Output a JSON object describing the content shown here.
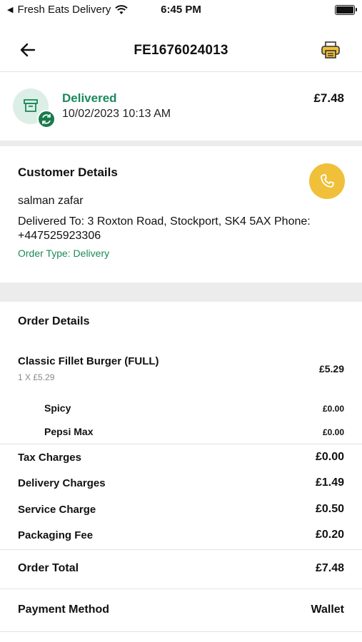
{
  "status_bar": {
    "carrier": "Fresh Eats Delivery",
    "time": "6:45 PM"
  },
  "header": {
    "title": "FE1676024013"
  },
  "summary": {
    "status": "Delivered",
    "datetime": "10/02/2023 10:13 AM",
    "amount": "£7.48"
  },
  "customer": {
    "heading": "Customer Details",
    "name": "salman zafar",
    "address": "Delivered To: 3 Roxton Road, Stockport, SK4 5AX Phone: +447525923306",
    "order_type": "Order Type: Delivery"
  },
  "order": {
    "heading": "Order Details",
    "item": {
      "name": "Classic Fillet Burger (FULL)",
      "qty": "1 X £5.29",
      "price": "£5.29"
    },
    "addons": [
      {
        "name": "Spicy",
        "price": "£0.00"
      },
      {
        "name": "Pepsi Max",
        "price": "£0.00"
      }
    ]
  },
  "charges": [
    {
      "label": "Tax Charges",
      "value": "£0.00"
    },
    {
      "label": "Delivery Charges",
      "value": "£1.49"
    },
    {
      "label": "Service Charge",
      "value": "£0.50"
    },
    {
      "label": "Packaging Fee",
      "value": "£0.20"
    }
  ],
  "total": {
    "label": "Order Total",
    "value": "£7.48"
  },
  "payment": {
    "label": "Payment Method",
    "value": "Wallet"
  },
  "colors": {
    "accent_green": "#1a8a5a",
    "call_yellow": "#f0c03a",
    "badge_green": "#1a7a4c"
  },
  "icons": [
    "back-arrow-icon",
    "printer-icon",
    "archive-box-icon",
    "refresh-icon",
    "phone-icon",
    "wifi-icon",
    "battery-icon"
  ]
}
